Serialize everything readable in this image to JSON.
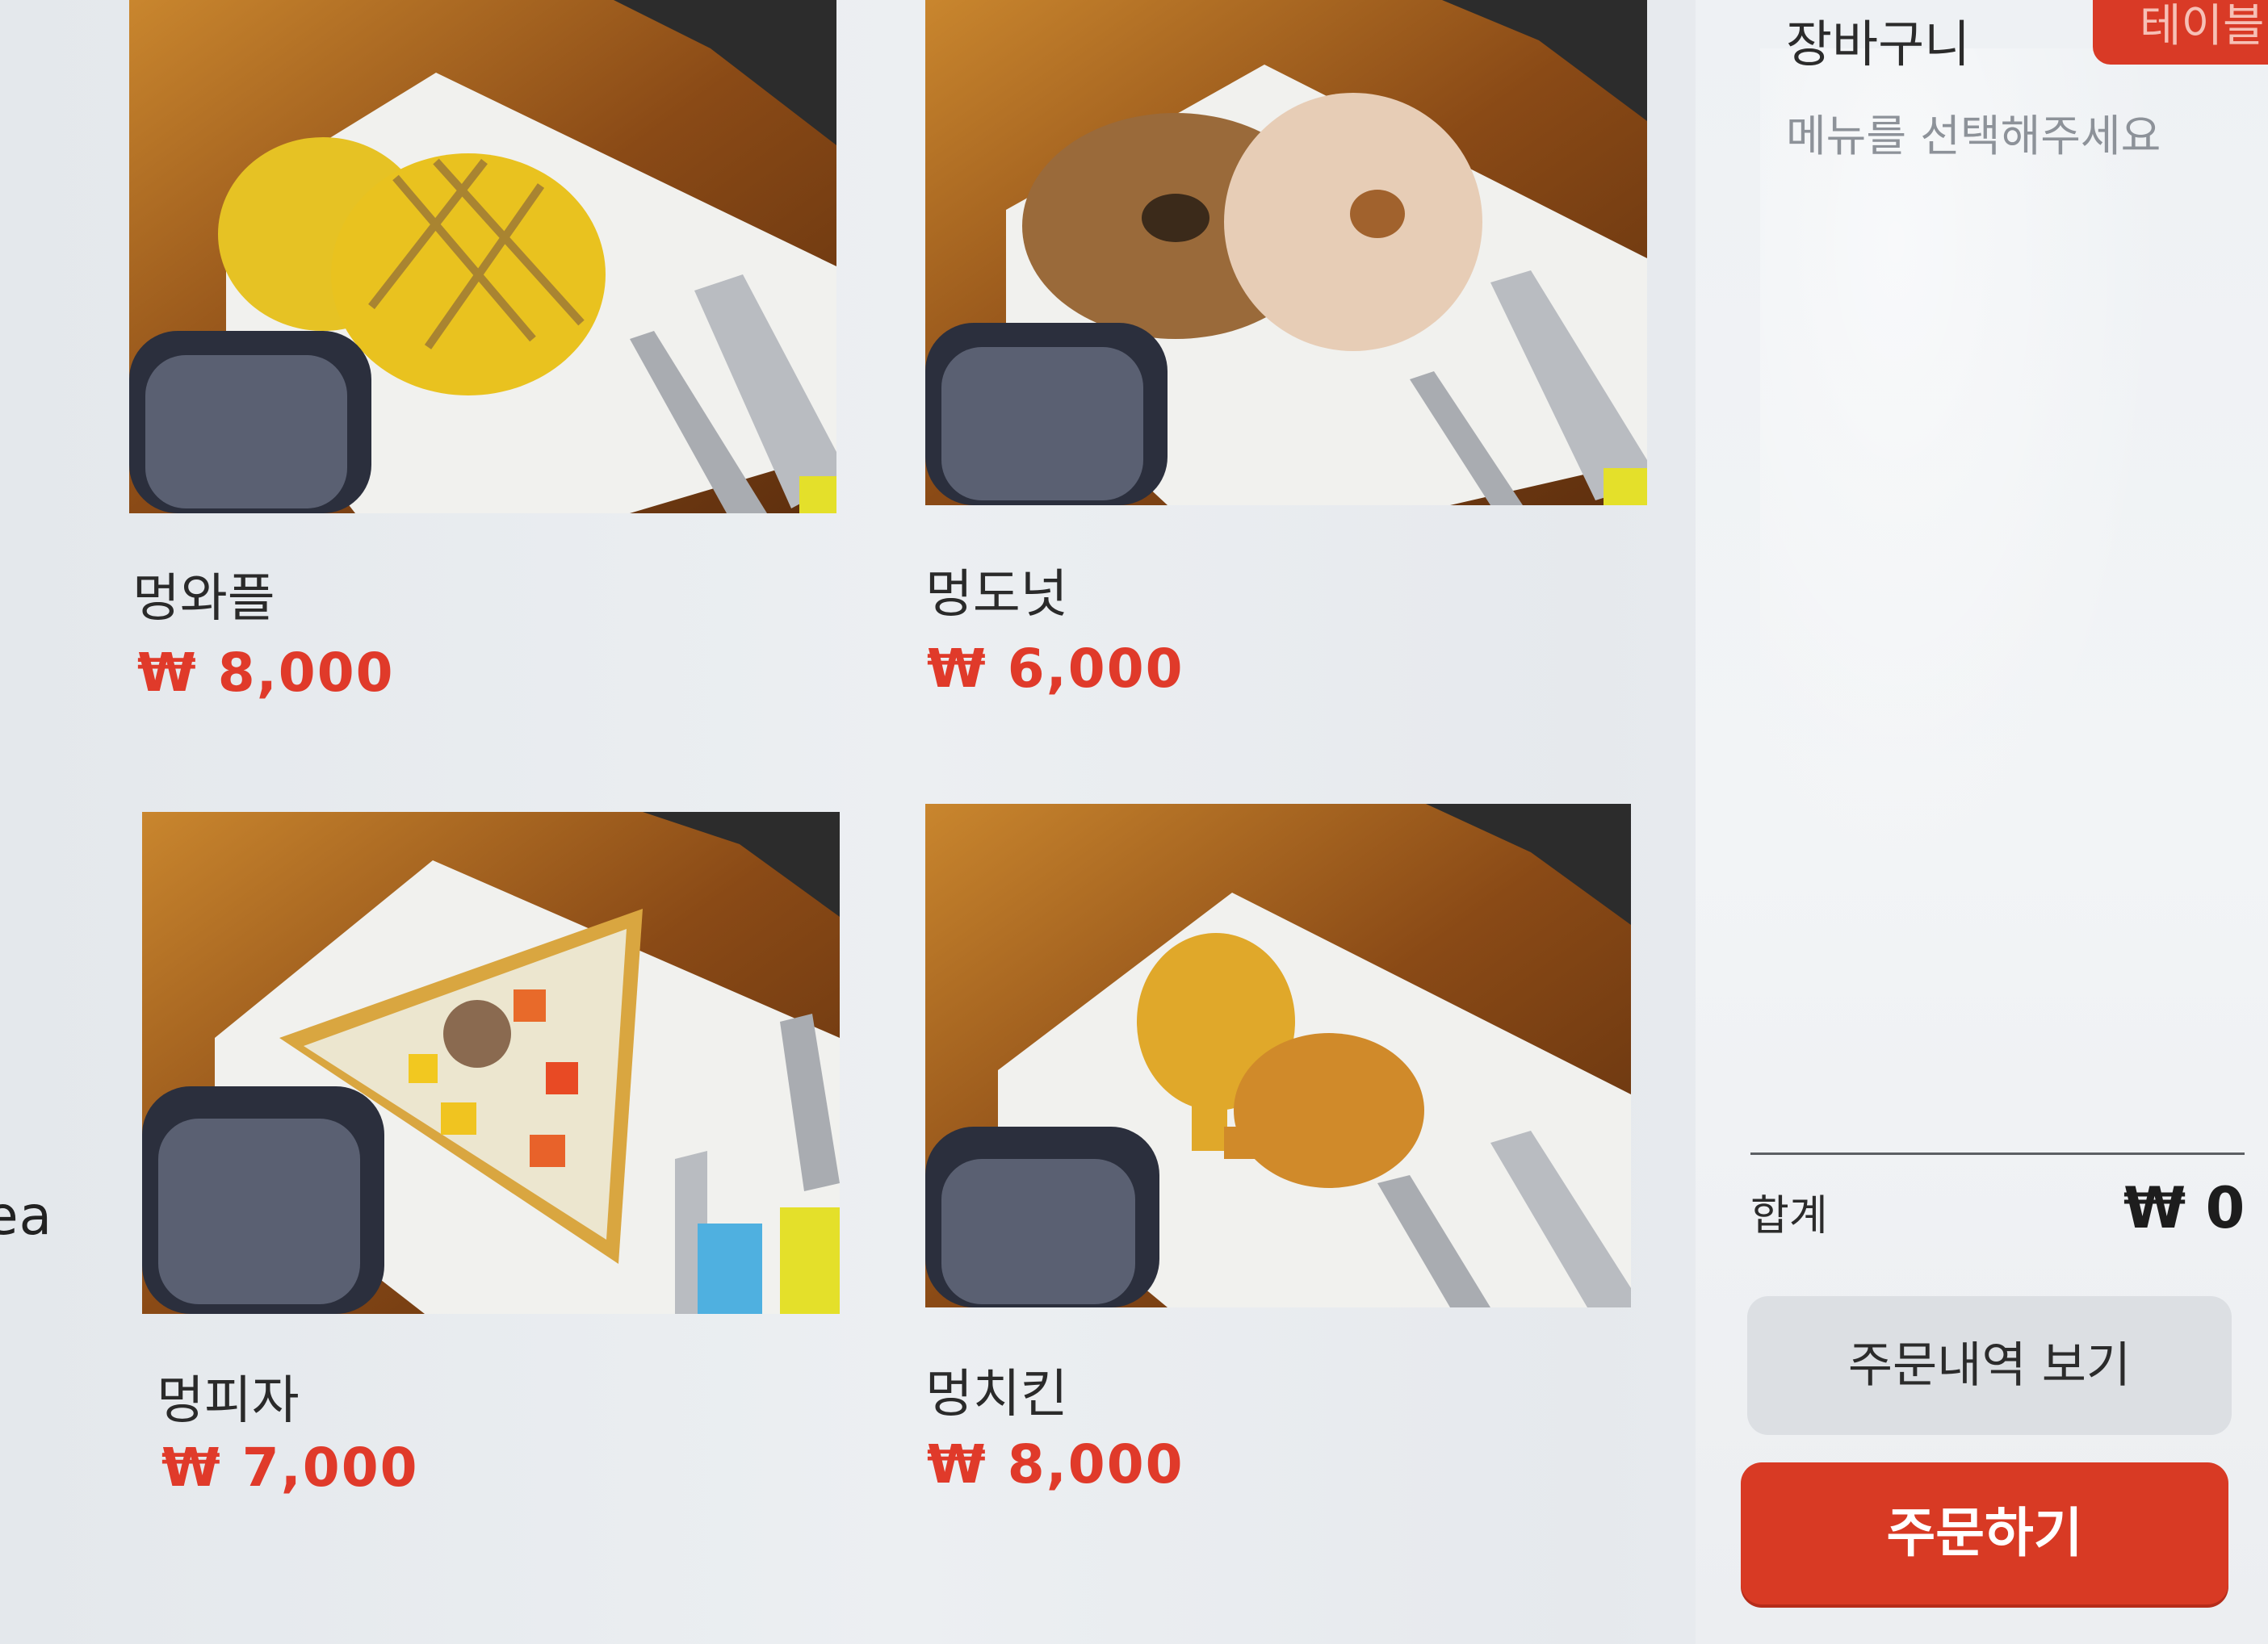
{
  "category_cut_text": "ea",
  "menu": {
    "items": [
      {
        "name": "멍와플",
        "price": "₩ 8,000",
        "photo": "waffle-photo"
      },
      {
        "name": "멍도넛",
        "price": "₩ 6,000",
        "photo": "donut-photo"
      },
      {
        "name": "멍피자",
        "price": "₩ 7,000",
        "photo": "pizza-photo"
      },
      {
        "name": "멍치킨",
        "price": "₩ 8,000",
        "photo": "chicken-photo"
      }
    ]
  },
  "cart": {
    "title": "장바구니",
    "top_button_label": "테이블",
    "empty_message": "메뉴를 선택해주세요",
    "total_label": "합계",
    "total_value": "₩ 0",
    "history_button": "주문내역 보기",
    "order_button": "주문하기"
  },
  "colors": {
    "price_red": "#e03a2a",
    "order_button_red": "#d83a24",
    "history_button_gray": "#dcdfe3"
  }
}
